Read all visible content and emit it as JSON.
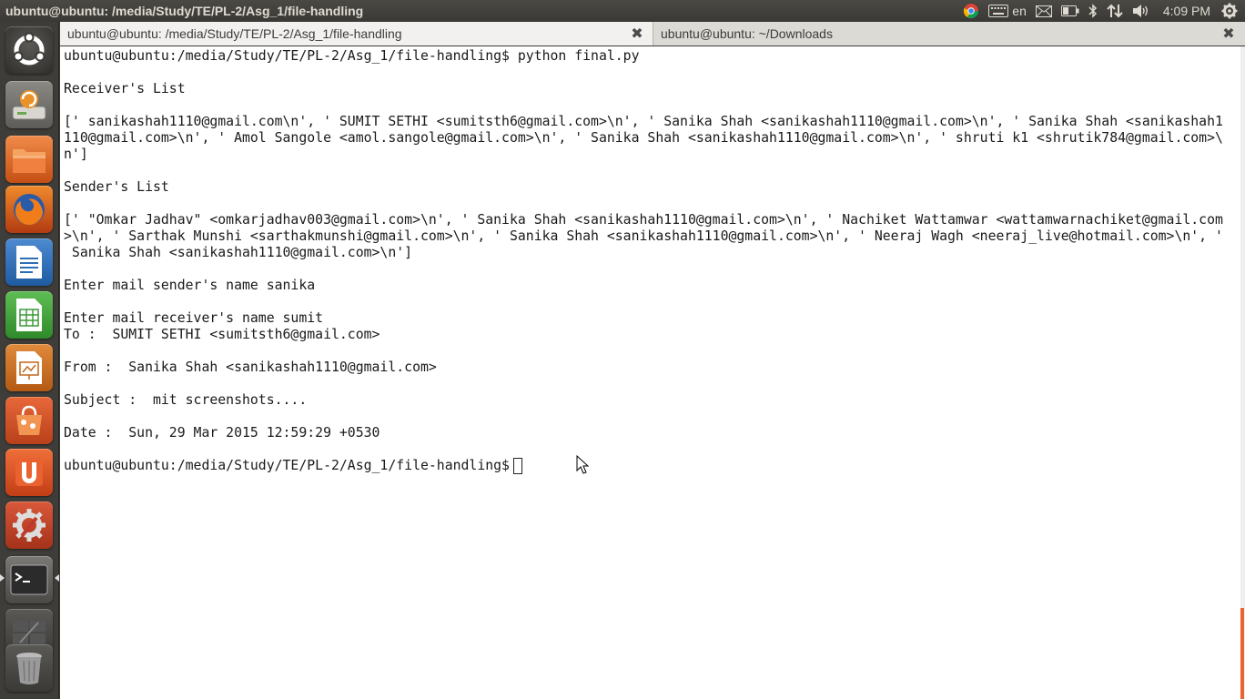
{
  "panel": {
    "window_title": "ubuntu@ubuntu: /media/Study/TE/PL-2/Asg_1/file-handling",
    "keyboard_layout": "en",
    "clock": "4:09 PM"
  },
  "launcher": {
    "items": [
      {
        "name": "dash-home-icon",
        "color": "#3a3935"
      },
      {
        "name": "ubuntu-one-backup-icon",
        "color": "#c2592a"
      },
      {
        "name": "files-icon",
        "color": "#d1581f"
      },
      {
        "name": "firefox-icon",
        "color": "#c4461d"
      },
      {
        "name": "libreoffice-writer-icon",
        "color": "#2c6fb6"
      },
      {
        "name": "libreoffice-calc-icon",
        "color": "#3f9a3a"
      },
      {
        "name": "libreoffice-impress-icon",
        "color": "#c0671c"
      },
      {
        "name": "software-center-icon",
        "color": "#d4512a"
      },
      {
        "name": "ubuntu-one-icon",
        "color": "#d9471d"
      },
      {
        "name": "system-settings-icon",
        "color": "#c4462a"
      },
      {
        "name": "terminal-icon",
        "color": "#5a5955"
      },
      {
        "name": "workspace-switcher-icon",
        "color": "#4a4945"
      },
      {
        "name": "trash-icon",
        "color": "#444340"
      }
    ]
  },
  "tabs": [
    {
      "label": "ubuntu@ubuntu: /media/Study/TE/PL-2/Asg_1/file-handling",
      "active": true
    },
    {
      "label": "ubuntu@ubuntu: ~/Downloads",
      "active": false
    }
  ],
  "terminal": {
    "lines": [
      "ubuntu@ubuntu:/media/Study/TE/PL-2/Asg_1/file-handling$ python final.py",
      "",
      "Receiver's List",
      "",
      "[' sanikashah1110@gmail.com\\n', ' SUMIT SETHI <sumitsth6@gmail.com>\\n', ' Sanika Shah <sanikashah1110@gmail.com>\\n', ' Sanika Shah <sanikashah1",
      "110@gmail.com>\\n', ' Amol Sangole <amol.sangole@gmail.com>\\n', ' Sanika Shah <sanikashah1110@gmail.com>\\n', ' shruti k1 <shrutik784@gmail.com>\\",
      "n']",
      "",
      "Sender's List",
      "",
      "[' \"Omkar Jadhav\" <omkarjadhav003@gmail.com>\\n', ' Sanika Shah <sanikashah1110@gmail.com>\\n', ' Nachiket Wattamwar <wattamwarnachiket@gmail.com",
      ">\\n', ' Sarthak Munshi <sarthakmunshi@gmail.com>\\n', ' Sanika Shah <sanikashah1110@gmail.com>\\n', ' Neeraj Wagh <neeraj_live@hotmail.com>\\n', '",
      " Sanika Shah <sanikashah1110@gmail.com>\\n']",
      "",
      "Enter mail sender's name sanika",
      "",
      "Enter mail receiver's name sumit",
      "To :  SUMIT SETHI <sumitsth6@gmail.com>",
      "",
      "From :  Sanika Shah <sanikashah1110@gmail.com>",
      "",
      "Subject :  mit screenshots....",
      "",
      "Date :  Sun, 29 Mar 2015 12:59:29 +0530",
      "",
      "ubuntu@ubuntu:/media/Study/TE/PL-2/Asg_1/file-handling$"
    ]
  },
  "colors": {
    "accent": "#e8672e",
    "panel_bg": "#3c3b37",
    "terminal_bg": "#ffffff"
  }
}
